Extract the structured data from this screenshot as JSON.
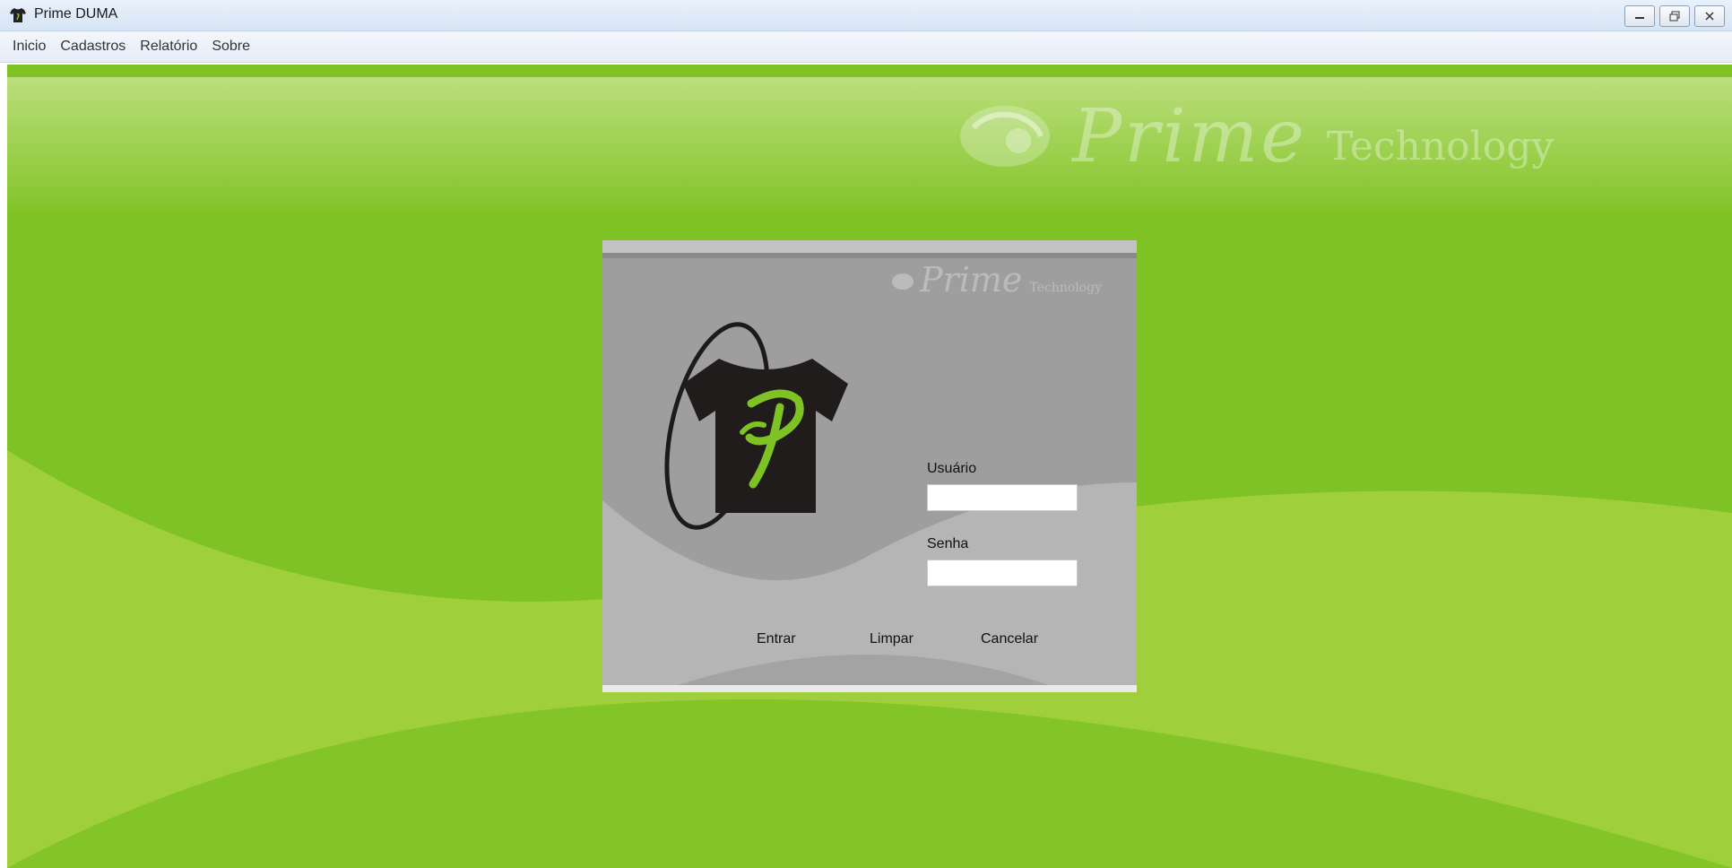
{
  "window": {
    "title": "Prime DUMA",
    "icon": "tshirt-app-icon"
  },
  "menu": {
    "items": [
      {
        "label": "Inicio"
      },
      {
        "label": "Cadastros"
      },
      {
        "label": "Relatório"
      },
      {
        "label": "Sobre"
      }
    ]
  },
  "brand": {
    "prime": "Prime",
    "technology": "Technology"
  },
  "login": {
    "usuario_label": "Usuário",
    "usuario_value": "",
    "senha_label": "Senha",
    "senha_value": "",
    "buttons": {
      "entrar": "Entrar",
      "limpar": "Limpar",
      "cancelar": "Cancelar"
    }
  },
  "colors": {
    "background_green": "#7fc224",
    "light_green": "#a6d444",
    "dialog_gray": "#9c9c9c",
    "logo_green": "#7fc224"
  }
}
